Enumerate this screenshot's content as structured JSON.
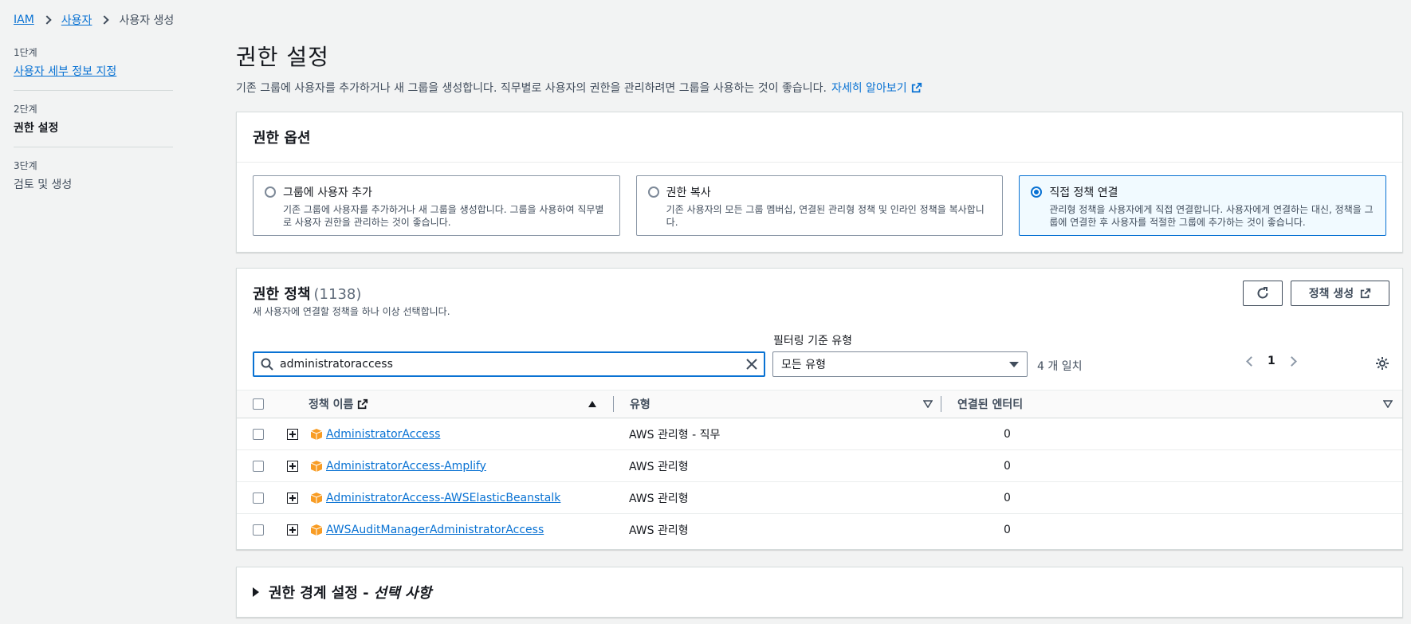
{
  "breadcrumb": {
    "item1": "IAM",
    "item2": "사용자",
    "current": "사용자 생성"
  },
  "steps": [
    {
      "num": "1단계",
      "label": "사용자 세부 정보 지정"
    },
    {
      "num": "2단계",
      "label": "권한 설정"
    },
    {
      "num": "3단계",
      "label": "검토 및 생성"
    }
  ],
  "page": {
    "title": "권한 설정",
    "description": "기존 그룹에 사용자를 추가하거나 새 그룹을 생성합니다. 직무별로 사용자의 권한을 관리하려면 그룹을 사용하는 것이 좋습니다.",
    "learn_more": "자세히 알아보기"
  },
  "permission_options": {
    "header": "권한 옵션",
    "options": [
      {
        "title": "그룹에 사용자 추가",
        "desc": "기존 그룹에 사용자를 추가하거나 새 그룹을 생성합니다. 그룹을 사용하여 직무별로 사용자 권한을 관리하는 것이 좋습니다.",
        "selected": false
      },
      {
        "title": "권한 복사",
        "desc": "기존 사용자의 모든 그룹 멤버십, 연결된 관리형 정책 및 인라인 정책을 복사합니다.",
        "selected": false
      },
      {
        "title": "직접 정책 연결",
        "desc": "관리형 정책을 사용자에게 직접 연결합니다. 사용자에게 연결하는 대신, 정책을 그룹에 연결한 후 사용자를 적절한 그룹에 추가하는 것이 좋습니다.",
        "selected": true
      }
    ]
  },
  "policies": {
    "title": "권한 정책",
    "count": "(1138)",
    "subtitle": "새 사용자에 연결할 정책을 하나 이상 선택합니다.",
    "create_button": "정책 생성",
    "filter_label": "필터링 기준 유형",
    "search_value": "administratoraccess",
    "type_filter": "모든 유형",
    "matches": "4 개 일치",
    "page": "1",
    "columns": {
      "name": "정책 이름",
      "type": "유형",
      "entities": "연결된 엔터티"
    },
    "rows": [
      {
        "name": "AdministratorAccess",
        "type": "AWS 관리형 - 직무",
        "entities": "0"
      },
      {
        "name": "AdministratorAccess-Amplify",
        "type": "AWS 관리형",
        "entities": "0"
      },
      {
        "name": "AdministratorAccess-AWSElasticBeanstalk",
        "type": "AWS 관리형",
        "entities": "0"
      },
      {
        "name": "AWSAuditManagerAdministratorAccess",
        "type": "AWS 관리형",
        "entities": "0"
      }
    ]
  },
  "boundary": {
    "title": "권한 경계 설정 -",
    "optional": "선택 사항"
  },
  "colors": {
    "link": "#0972d3",
    "accent_border": "#0972d3",
    "policy_icon": "#f89c24"
  }
}
